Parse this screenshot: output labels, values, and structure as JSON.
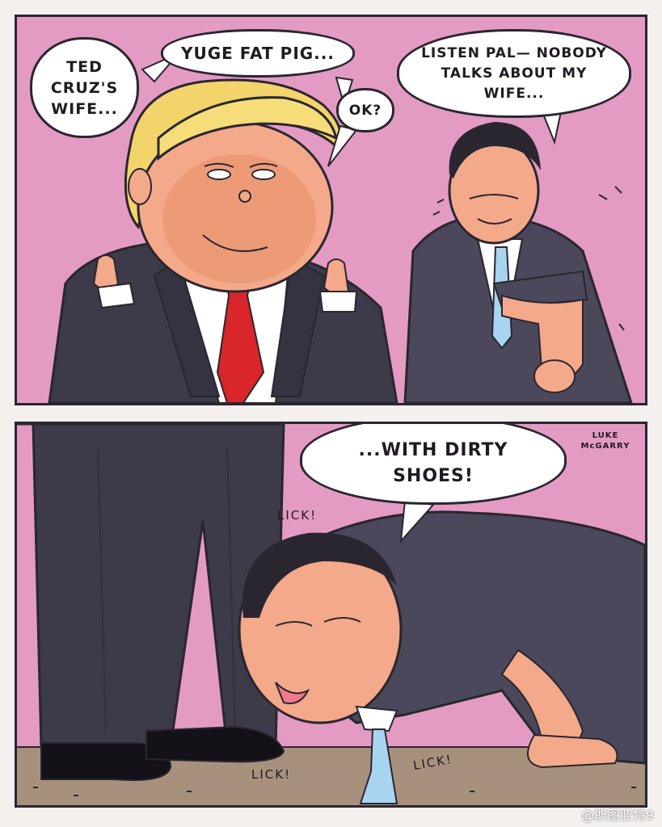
{
  "panel_top": {
    "bubble_ted": "TED CRUZ'S WIFE...",
    "bubble_yuge": "YUGE FAT PIG...",
    "bubble_ok": "OK?",
    "bubble_listen": "LISTEN PAL— NOBODY TALKS ABOUT MY WIFE..."
  },
  "panel_bottom": {
    "bubble_dirty": "...WITH DIRTY SHOES!",
    "lick_1": "LICK!",
    "lick_2": "LICK!",
    "lick_3": "LICK!",
    "signature": "LUKE McGARRY"
  },
  "watermark": "@斯图亚特9",
  "colors": {
    "background_pink": "#e39bc4",
    "suit_dark": "#3d3b4a",
    "skin": "#f3a98a",
    "tie_red": "#d8262a",
    "tie_blue": "#a8d4f0",
    "ground": "#a8917c"
  }
}
